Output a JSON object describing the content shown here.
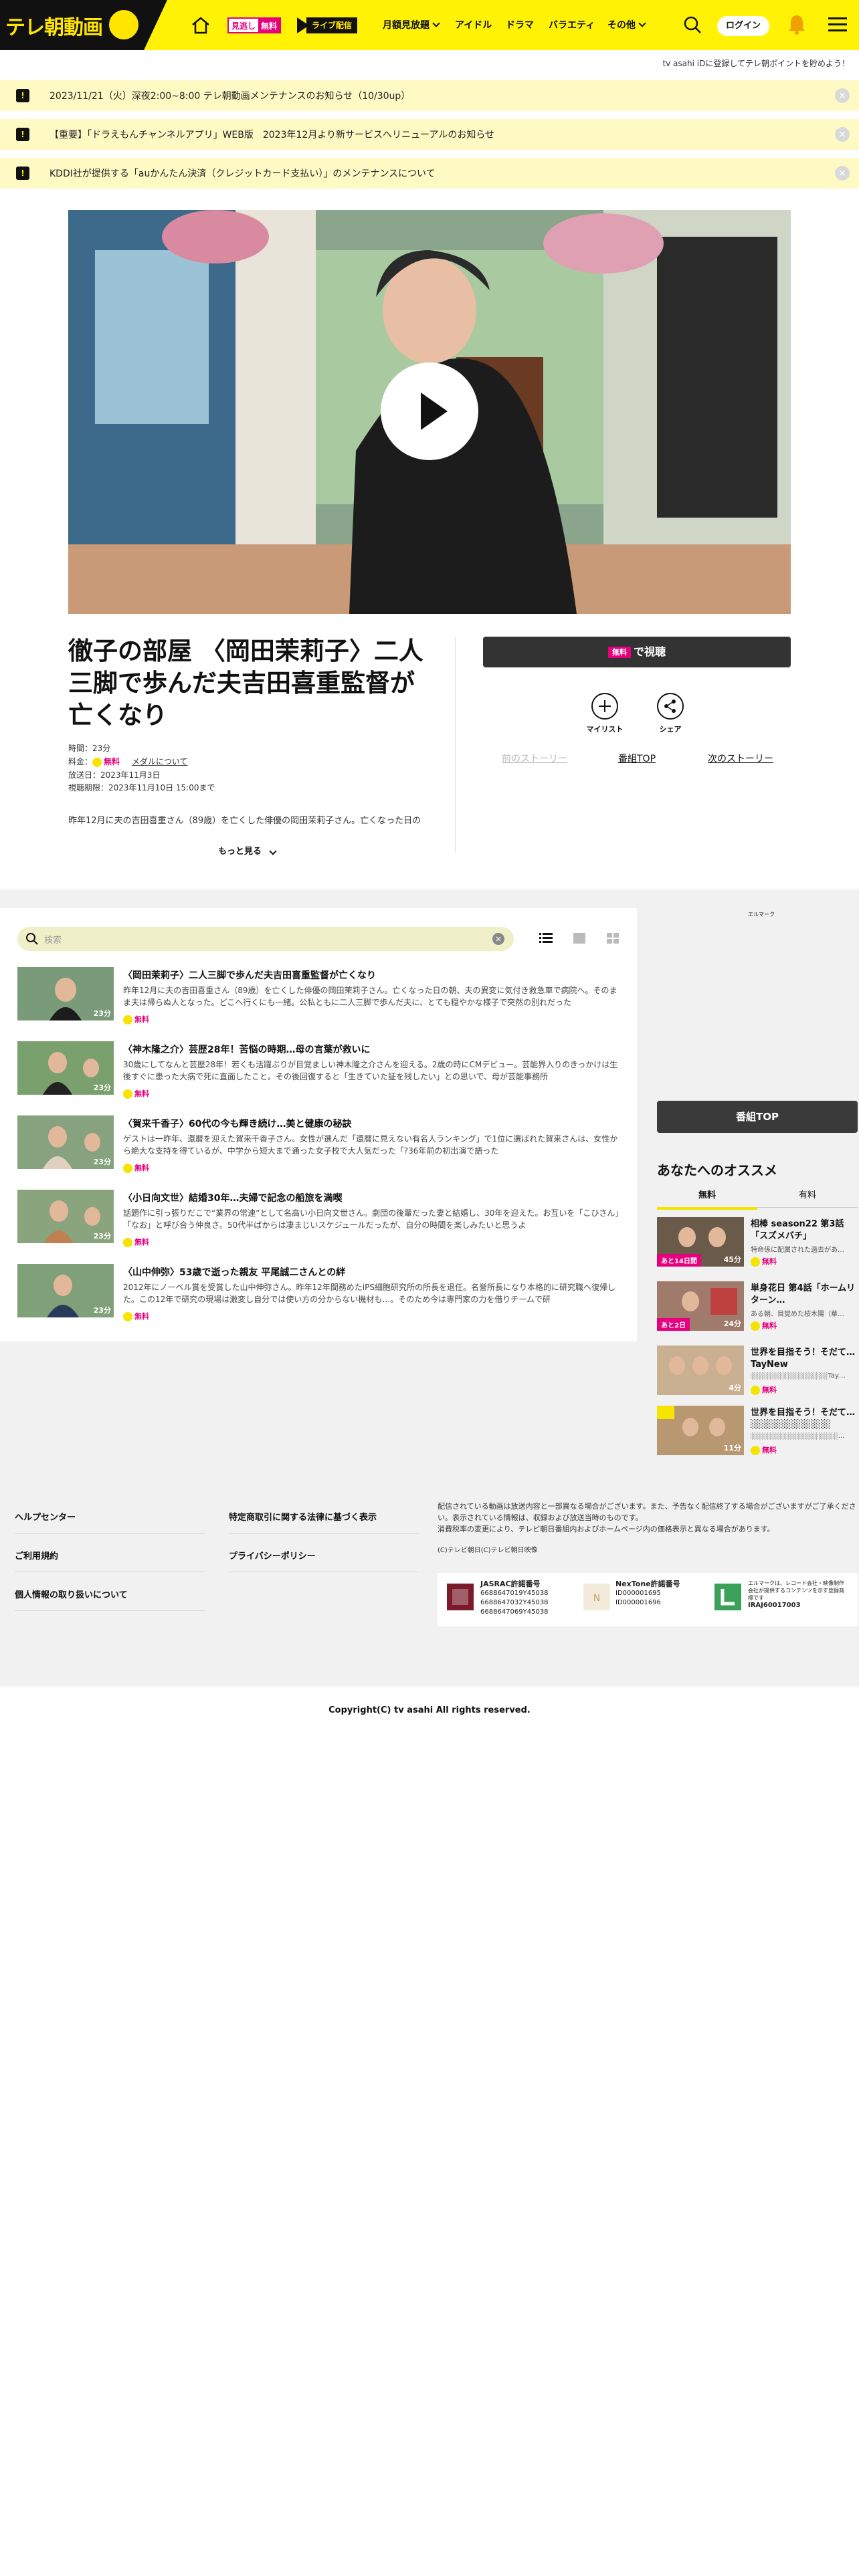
{
  "header": {
    "logo": "テレ朝動画",
    "mitsukoshi": [
      "見逃し",
      "無料"
    ],
    "live_label": "ライブ配信",
    "nav": [
      "月額見放題",
      "アイドル",
      "ドラマ",
      "バラエティ",
      "その他"
    ],
    "login": "ログイン",
    "tvid_note": "tv asahi iDに登録してテレ朝ポイントを貯めよう！"
  },
  "notices": [
    "2023/11/21（火）深夜2:00~8:00 テレ朝動画メンテナンスのお知らせ（10/30up）",
    "【重要】「ドラえもんチャンネルアプリ」WEB版　2023年12月より新サービスへリニューアルのお知らせ",
    "KDDI社が提供する「auかんたん決済（クレジットカード支払い）」のメンテナンスについて"
  ],
  "episode": {
    "title": "徹子の部屋 〈岡田茉莉子〉二人三脚で歩んだ夫吉田喜重監督が亡くなり",
    "duration": "時間：23分",
    "fee_label": "料金：",
    "fee_value": "無料",
    "medal_link": "メダルについて",
    "air_date": "放送日：2023年11月3日",
    "expiry": "視聴期限：2023年11月10日 15:00まで",
    "description": "昨年12月に夫の吉田喜重さん（89歳）を亡くした俳優の岡田茉莉子さん。亡くなった日の",
    "more": "もっと見る"
  },
  "actions": {
    "watch_badge": "無料",
    "watch_label": "で視聴",
    "mylist": "マイリスト",
    "share": "シェア",
    "prev": "前のストーリー",
    "top": "番組TOP",
    "next": "次のストーリー"
  },
  "list": {
    "search_placeholder": "検索",
    "items": [
      {
        "title": "〈岡田茉莉子〉二人三脚で歩んだ夫吉田喜重監督が亡くなり",
        "desc": "昨年12月に夫の吉田喜重さん（89歳）を亡くした俳優の岡田茉莉子さん。亡くなった日の朝、夫の異変に気付き救急車で病院へ。そのまま夫は帰らぬ人となった。どこへ行くにも一緒。公私ともに二人三脚で歩んだ夫に、とても穏やかな様子で突然の別れだった",
        "duration": "23分",
        "badge": "無料"
      },
      {
        "title": "〈神木隆之介〉芸歴28年！苦悩の時期…母の言葉が救いに",
        "desc": "30歳にしてなんと芸歴28年！若くも活躍ぶりが目覚ましい神木隆之介さんを迎える。2歳の時にCMデビュー。芸能界入りのきっかけは生後すぐに患った大病で死に直面したこと。その後回復すると「生きていた証を残したい」との思いで、母が芸能事務所",
        "duration": "23分",
        "badge": "無料"
      },
      {
        "title": "〈賀来千香子〉60代の今も輝き続け…美と健康の秘訣",
        "desc": "ゲストは一昨年、還暦を迎えた賀来千香子さん。女性が選んだ「還暦に見えない有名人ランキング」で1位に選ばれた賀来さんは、女性から絶大な支持を得ているが、中学から短大まで通った女子校で大人気だった「?36年前の初出演で語った",
        "duration": "23分",
        "badge": "無料"
      },
      {
        "title": "〈小日向文世〉結婚30年…夫婦で記念の船旅を満喫",
        "desc": "話題作に引っ張りだこで“業界の常連”として名高い小日向文世さん。劇団の後輩だった妻と結婚し、30年を迎えた。お互いを「こひさん」「なお」と呼び合う仲良さ。50代半ばからは凄まじいスケジュールだったが、自分の時間を楽しみたいと思うよ",
        "duration": "23分",
        "badge": "無料"
      },
      {
        "title": "〈山中伸弥〉53歳で逝った親友 平尾誠二さんとの絆",
        "desc": "2012年にノーベル賞を受賞した山中伸弥さん。昨年12年間務めたiPS細胞研究所の所長を退任。名誉所長になり本格的に研究職へ復帰した。この12年で研究の現場は激変し自分では使い方の分からない機材も…。そのため今は専門家の力を借りチームで研",
        "duration": "23分",
        "badge": "無料"
      }
    ]
  },
  "sidebar": {
    "top_button": "番組TOP",
    "rec_title": "あなたへのオススメ",
    "tabs": [
      "無料",
      "有料"
    ],
    "recs": [
      {
        "title": "相棒 season22 第3話「スズメバチ」",
        "sub": "特命係に配属された過去があ…",
        "badge": "無料",
        "band": "あと14日間",
        "duration": "45分"
      },
      {
        "title": "単身花日 第4話「ホームリターン…",
        "sub": "ある朝、目覚めた桜木陽（華…",
        "badge": "無料",
        "band": "あと2日",
        "duration": "24分"
      },
      {
        "title": "世界を目指そう！そだて… TayNew ░░░░░░░░░░",
        "sub": "░░░░░░░░░░░░░░░Tay…",
        "badge": "無料",
        "band": "",
        "duration": "4分"
      },
      {
        "title": "世界を目指そう！そだて… ░░░░░░░░░░░░",
        "sub": "░░░░░░░░░░░░░░░░░…",
        "badge": "無料",
        "band": "",
        "duration": "11分"
      }
    ]
  },
  "footer": {
    "links_left": [
      "ヘルプセンター",
      "ご利用規約",
      "個人情報の取り扱いについて"
    ],
    "links_mid": [
      "特定商取引に関する法律に基づく表示",
      "プライバシーポリシー"
    ],
    "notes": [
      "配信されている動画は放送内容と一部異なる場合がございます。また、予告なく配信終了する場合がございますがご了承ください。表示されている情報は、収録および放送当時のものです。",
      "消費税率の変更により、テレビ朝日番組内およびホームページ内の価格表示と異なる場合があります。",
      "(C)テレビ朝日(C)テレビ朝日映像"
    ],
    "certs": [
      {
        "name": "JASRAC許諾番号",
        "nums": [
          "6688647019Y45038",
          "6688647032Y45038",
          "6688647069Y45038"
        ]
      },
      {
        "name": "NexTone許諾番号",
        "nums": [
          "ID000001695",
          "ID000001696"
        ]
      },
      {
        "name": "エルマーク",
        "nums": [
          "エルマークは、レコード会社・映像制作会社が提供するコンテンツを示す登録商標です",
          "IRAJ60017003"
        ]
      }
    ],
    "copyright": "Copyright(C) tv asahi All rights reserved."
  }
}
